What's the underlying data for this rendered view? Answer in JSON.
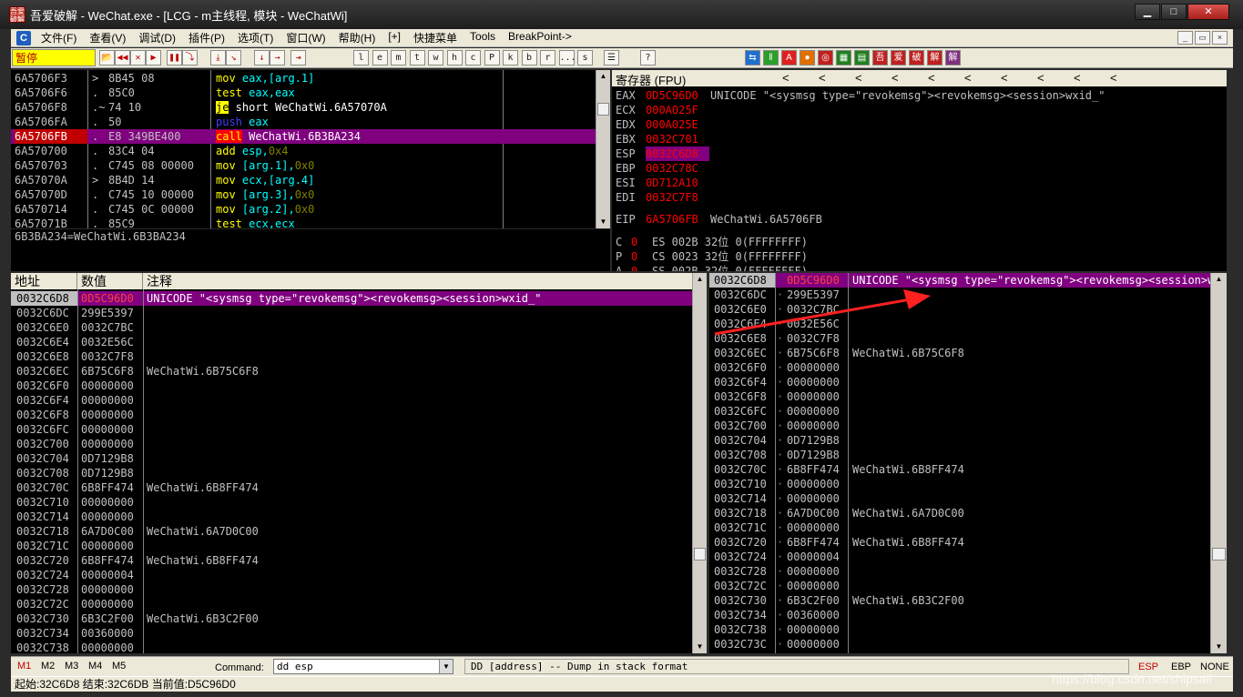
{
  "window": {
    "app_icon_text": "吾爱破解",
    "title": "吾爱破解 - WeChat.exe - [LCG - m主线程, 模块 - WeChatWi]",
    "min": "▁",
    "max": "□",
    "close": "✕"
  },
  "menu": {
    "logo": "C",
    "items": [
      "文件(F)",
      "查看(V)",
      "调试(D)",
      "插件(P)",
      "选项(T)",
      "窗口(W)",
      "帮助(H)",
      "[+]",
      "快捷菜单",
      "Tools",
      "BreakPoint->"
    ],
    "mdi_min": "_",
    "mdi_restore": "▭",
    "mdi_close": "×"
  },
  "toolbar": {
    "status": "暂停",
    "nav_buttons": [
      "📂",
      "◀◀",
      "✕",
      "▶",
      "❚❚",
      "⤵",
      "⤓",
      "↘",
      "↓",
      "→",
      "⇥"
    ],
    "letter_buttons": [
      "l",
      "e",
      "m",
      "t",
      "w",
      "h",
      "c",
      "P",
      "k",
      "b",
      "r",
      "...",
      "s"
    ],
    "right_buttons": [
      "☰",
      "?"
    ],
    "plugin_buttons": [
      "⇆",
      "‖",
      "A",
      "●",
      "◎",
      "▦",
      "▤",
      "吾",
      "爱",
      "破",
      "解",
      "解"
    ]
  },
  "colors": {
    "address": "#c0c0c0",
    "hex_bytes": "#c0c0c0",
    "mnemonic_yellow": "#ffff00",
    "operand_cyan": "#00ffff",
    "number": "#808000",
    "push_blue": "#4040ff",
    "jump_highlight": "#ffff00",
    "call_highlight": "#ff0000",
    "selected": "#800080",
    "reg_changed": "#ff0000",
    "comment": "#c0c0c0"
  },
  "disasm": {
    "rows": [
      {
        "addr": "6A5706F3",
        "mark": ">",
        "bytes": "8B45 08",
        "instr": [
          [
            "mov ",
            "yellow"
          ],
          [
            "eax,[arg.1]",
            "cyan"
          ]
        ]
      },
      {
        "addr": "6A5706F6",
        "mark": ".",
        "bytes": "85C0",
        "instr": [
          [
            "test ",
            "yellow"
          ],
          [
            "eax,eax",
            "cyan"
          ]
        ]
      },
      {
        "addr": "6A5706F8",
        "mark": ".~",
        "bytes": "74 10",
        "instr": [
          [
            "je",
            "jump"
          ],
          [
            " short WeChatWi.6A57070A",
            "white"
          ]
        ]
      },
      {
        "addr": "6A5706FA",
        "mark": ".",
        "bytes": "50",
        "instr": [
          [
            "push ",
            "blue"
          ],
          [
            "eax",
            "cyan"
          ]
        ]
      },
      {
        "addr": "6A5706FB",
        "mark": ".",
        "bytes": "E8 349BE400",
        "instr": [
          [
            "call",
            "call"
          ],
          [
            " WeChatWi.6B3BA234",
            "white"
          ]
        ],
        "selected": true
      },
      {
        "addr": "6A570700",
        "mark": ".",
        "bytes": "83C4 04",
        "instr": [
          [
            "add ",
            "yellow"
          ],
          [
            "esp,",
            "cyan"
          ],
          [
            "0x4",
            "number"
          ]
        ]
      },
      {
        "addr": "6A570703",
        "mark": ".",
        "bytes": "C745 08 00000",
        "instr": [
          [
            "mov ",
            "yellow"
          ],
          [
            "[arg.1],",
            "cyan"
          ],
          [
            "0x0",
            "number"
          ]
        ]
      },
      {
        "addr": "6A57070A",
        "mark": ">",
        "bytes": "8B4D 14",
        "instr": [
          [
            "mov ",
            "yellow"
          ],
          [
            "ecx,[arg.4]",
            "cyan"
          ]
        ]
      },
      {
        "addr": "6A57070D",
        "mark": ".",
        "bytes": "C745 10 00000",
        "instr": [
          [
            "mov ",
            "yellow"
          ],
          [
            "[arg.3],",
            "cyan"
          ],
          [
            "0x0",
            "number"
          ]
        ]
      },
      {
        "addr": "6A570714",
        "mark": ".",
        "bytes": "C745 0C 00000",
        "instr": [
          [
            "mov ",
            "yellow"
          ],
          [
            "[arg.2],",
            "cyan"
          ],
          [
            "0x0",
            "number"
          ]
        ]
      },
      {
        "addr": "6A57071B",
        "mark": ".",
        "bytes": "85C9",
        "instr": [
          [
            "test ",
            "yellow"
          ],
          [
            "ecx,ecx",
            "cyan"
          ]
        ]
      }
    ]
  },
  "info_line": "6B3BA234=WeChatWi.6B3BA234",
  "registers": {
    "title": "寄存器 (FPU)",
    "arrow": "<",
    "lines": [
      {
        "name": "EAX",
        "value": "0D5C96D0",
        "comment": "UNICODE \"<sysmsg type=\"revokemsg\"><revokemsg><session>wxid_\""
      },
      {
        "name": "ECX",
        "value": "000A025F",
        "comment": ""
      },
      {
        "name": "EDX",
        "value": "000A025E",
        "comment": ""
      },
      {
        "name": "EBX",
        "value": "0032C701",
        "comment": ""
      },
      {
        "name": "ESP",
        "value": "0032C6D8",
        "comment": "",
        "selected": true
      },
      {
        "name": "EBP",
        "value": "0032C78C",
        "comment": ""
      },
      {
        "name": "ESI",
        "value": "0D712A10",
        "comment": ""
      },
      {
        "name": "EDI",
        "value": "0032C7F8",
        "comment": ""
      }
    ],
    "eip": {
      "name": "EIP",
      "value": "6A5706FB",
      "comment": "WeChatWi.6A5706FB"
    },
    "flags": [
      {
        "flag": "C",
        "val": "0",
        "seg": "ES 002B 32位 0(FFFFFFFF)"
      },
      {
        "flag": "P",
        "val": "0",
        "seg": "CS 0023 32位 0(FFFFFFFF)"
      },
      {
        "flag": "A",
        "val": "0",
        "seg": "SS 002B 32位 0(FFFFFFFF)"
      }
    ]
  },
  "dump": {
    "headers": [
      "地址",
      "数值",
      "注释"
    ],
    "rows": [
      {
        "addr": "0032C6D8",
        "value": "0D5C96D0",
        "comment": "UNICODE \"<sysmsg type=\"revokemsg\"><revokemsg><session>wxid_\"",
        "selected": true
      },
      {
        "addr": "0032C6DC",
        "value": "299E5397",
        "comment": ""
      },
      {
        "addr": "0032C6E0",
        "value": "0032C7BC",
        "comment": ""
      },
      {
        "addr": "0032C6E4",
        "value": "0032E56C",
        "comment": ""
      },
      {
        "addr": "0032C6E8",
        "value": "0032C7F8",
        "comment": ""
      },
      {
        "addr": "0032C6EC",
        "value": "6B75C6F8",
        "comment": "WeChatWi.6B75C6F8"
      },
      {
        "addr": "0032C6F0",
        "value": "00000000",
        "comment": ""
      },
      {
        "addr": "0032C6F4",
        "value": "00000000",
        "comment": ""
      },
      {
        "addr": "0032C6F8",
        "value": "00000000",
        "comment": ""
      },
      {
        "addr": "0032C6FC",
        "value": "00000000",
        "comment": ""
      },
      {
        "addr": "0032C700",
        "value": "00000000",
        "comment": ""
      },
      {
        "addr": "0032C704",
        "value": "0D7129B8",
        "comment": ""
      },
      {
        "addr": "0032C708",
        "value": "0D7129B8",
        "comment": ""
      },
      {
        "addr": "0032C70C",
        "value": "6B8FF474",
        "comment": "WeChatWi.6B8FF474"
      },
      {
        "addr": "0032C710",
        "value": "00000000",
        "comment": ""
      },
      {
        "addr": "0032C714",
        "value": "00000000",
        "comment": ""
      },
      {
        "addr": "0032C718",
        "value": "6A7D0C00",
        "comment": "WeChatWi.6A7D0C00"
      },
      {
        "addr": "0032C71C",
        "value": "00000000",
        "comment": ""
      },
      {
        "addr": "0032C720",
        "value": "6B8FF474",
        "comment": "WeChatWi.6B8FF474"
      },
      {
        "addr": "0032C724",
        "value": "00000004",
        "comment": ""
      },
      {
        "addr": "0032C728",
        "value": "00000000",
        "comment": ""
      },
      {
        "addr": "0032C72C",
        "value": "00000000",
        "comment": ""
      },
      {
        "addr": "0032C730",
        "value": "6B3C2F00",
        "comment": "WeChatWi.6B3C2F00"
      },
      {
        "addr": "0032C734",
        "value": "00360000",
        "comment": ""
      },
      {
        "addr": "0032C738",
        "value": "00000000",
        "comment": ""
      }
    ]
  },
  "stack": {
    "rows": [
      {
        "addr": "0032C6D8",
        "value": "0D5C96D0",
        "comment": "UNICODE \"<sysmsg type=\"revokemsg\"><revokemsg><session>wxid_\"",
        "selected": true
      },
      {
        "addr": "0032C6DC",
        "value": "299E5397",
        "comment": ""
      },
      {
        "addr": "0032C6E0",
        "value": "0032C7BC",
        "comment": ""
      },
      {
        "addr": "0032C6E4",
        "value": "0032E56C",
        "comment": ""
      },
      {
        "addr": "0032C6E8",
        "value": "0032C7F8",
        "comment": ""
      },
      {
        "addr": "0032C6EC",
        "value": "6B75C6F8",
        "comment": "WeChatWi.6B75C6F8"
      },
      {
        "addr": "0032C6F0",
        "value": "00000000",
        "comment": ""
      },
      {
        "addr": "0032C6F4",
        "value": "00000000",
        "comment": ""
      },
      {
        "addr": "0032C6F8",
        "value": "00000000",
        "comment": ""
      },
      {
        "addr": "0032C6FC",
        "value": "00000000",
        "comment": ""
      },
      {
        "addr": "0032C700",
        "value": "00000000",
        "comment": ""
      },
      {
        "addr": "0032C704",
        "value": "0D7129B8",
        "comment": ""
      },
      {
        "addr": "0032C708",
        "value": "0D7129B8",
        "comment": ""
      },
      {
        "addr": "0032C70C",
        "value": "6B8FF474",
        "comment": "WeChatWi.6B8FF474"
      },
      {
        "addr": "0032C710",
        "value": "00000000",
        "comment": ""
      },
      {
        "addr": "0032C714",
        "value": "00000000",
        "comment": ""
      },
      {
        "addr": "0032C718",
        "value": "6A7D0C00",
        "comment": "WeChatWi.6A7D0C00"
      },
      {
        "addr": "0032C71C",
        "value": "00000000",
        "comment": ""
      },
      {
        "addr": "0032C720",
        "value": "6B8FF474",
        "comment": "WeChatWi.6B8FF474"
      },
      {
        "addr": "0032C724",
        "value": "00000004",
        "comment": ""
      },
      {
        "addr": "0032C728",
        "value": "00000000",
        "comment": ""
      },
      {
        "addr": "0032C72C",
        "value": "00000000",
        "comment": ""
      },
      {
        "addr": "0032C730",
        "value": "6B3C2F00",
        "comment": "WeChatWi.6B3C2F00"
      },
      {
        "addr": "0032C734",
        "value": "00360000",
        "comment": ""
      },
      {
        "addr": "0032C738",
        "value": "00000000",
        "comment": ""
      },
      {
        "addr": "0032C73C",
        "value": "00000000",
        "comment": ""
      }
    ]
  },
  "command_bar": {
    "tabs": [
      "M1",
      "M2",
      "M3",
      "M4",
      "M5"
    ],
    "label": "Command:",
    "value": "dd esp",
    "dropdown": "▼",
    "help": "DD [address] -- Dump in stack format",
    "reg_tabs": [
      "ESP",
      "EBP",
      "NONE"
    ]
  },
  "statusbar": {
    "text": "起始:32C6D8 结束:32C6DB 当前值:D5C96D0"
  },
  "watermark": "https://blog.csdn.net/shipsail"
}
